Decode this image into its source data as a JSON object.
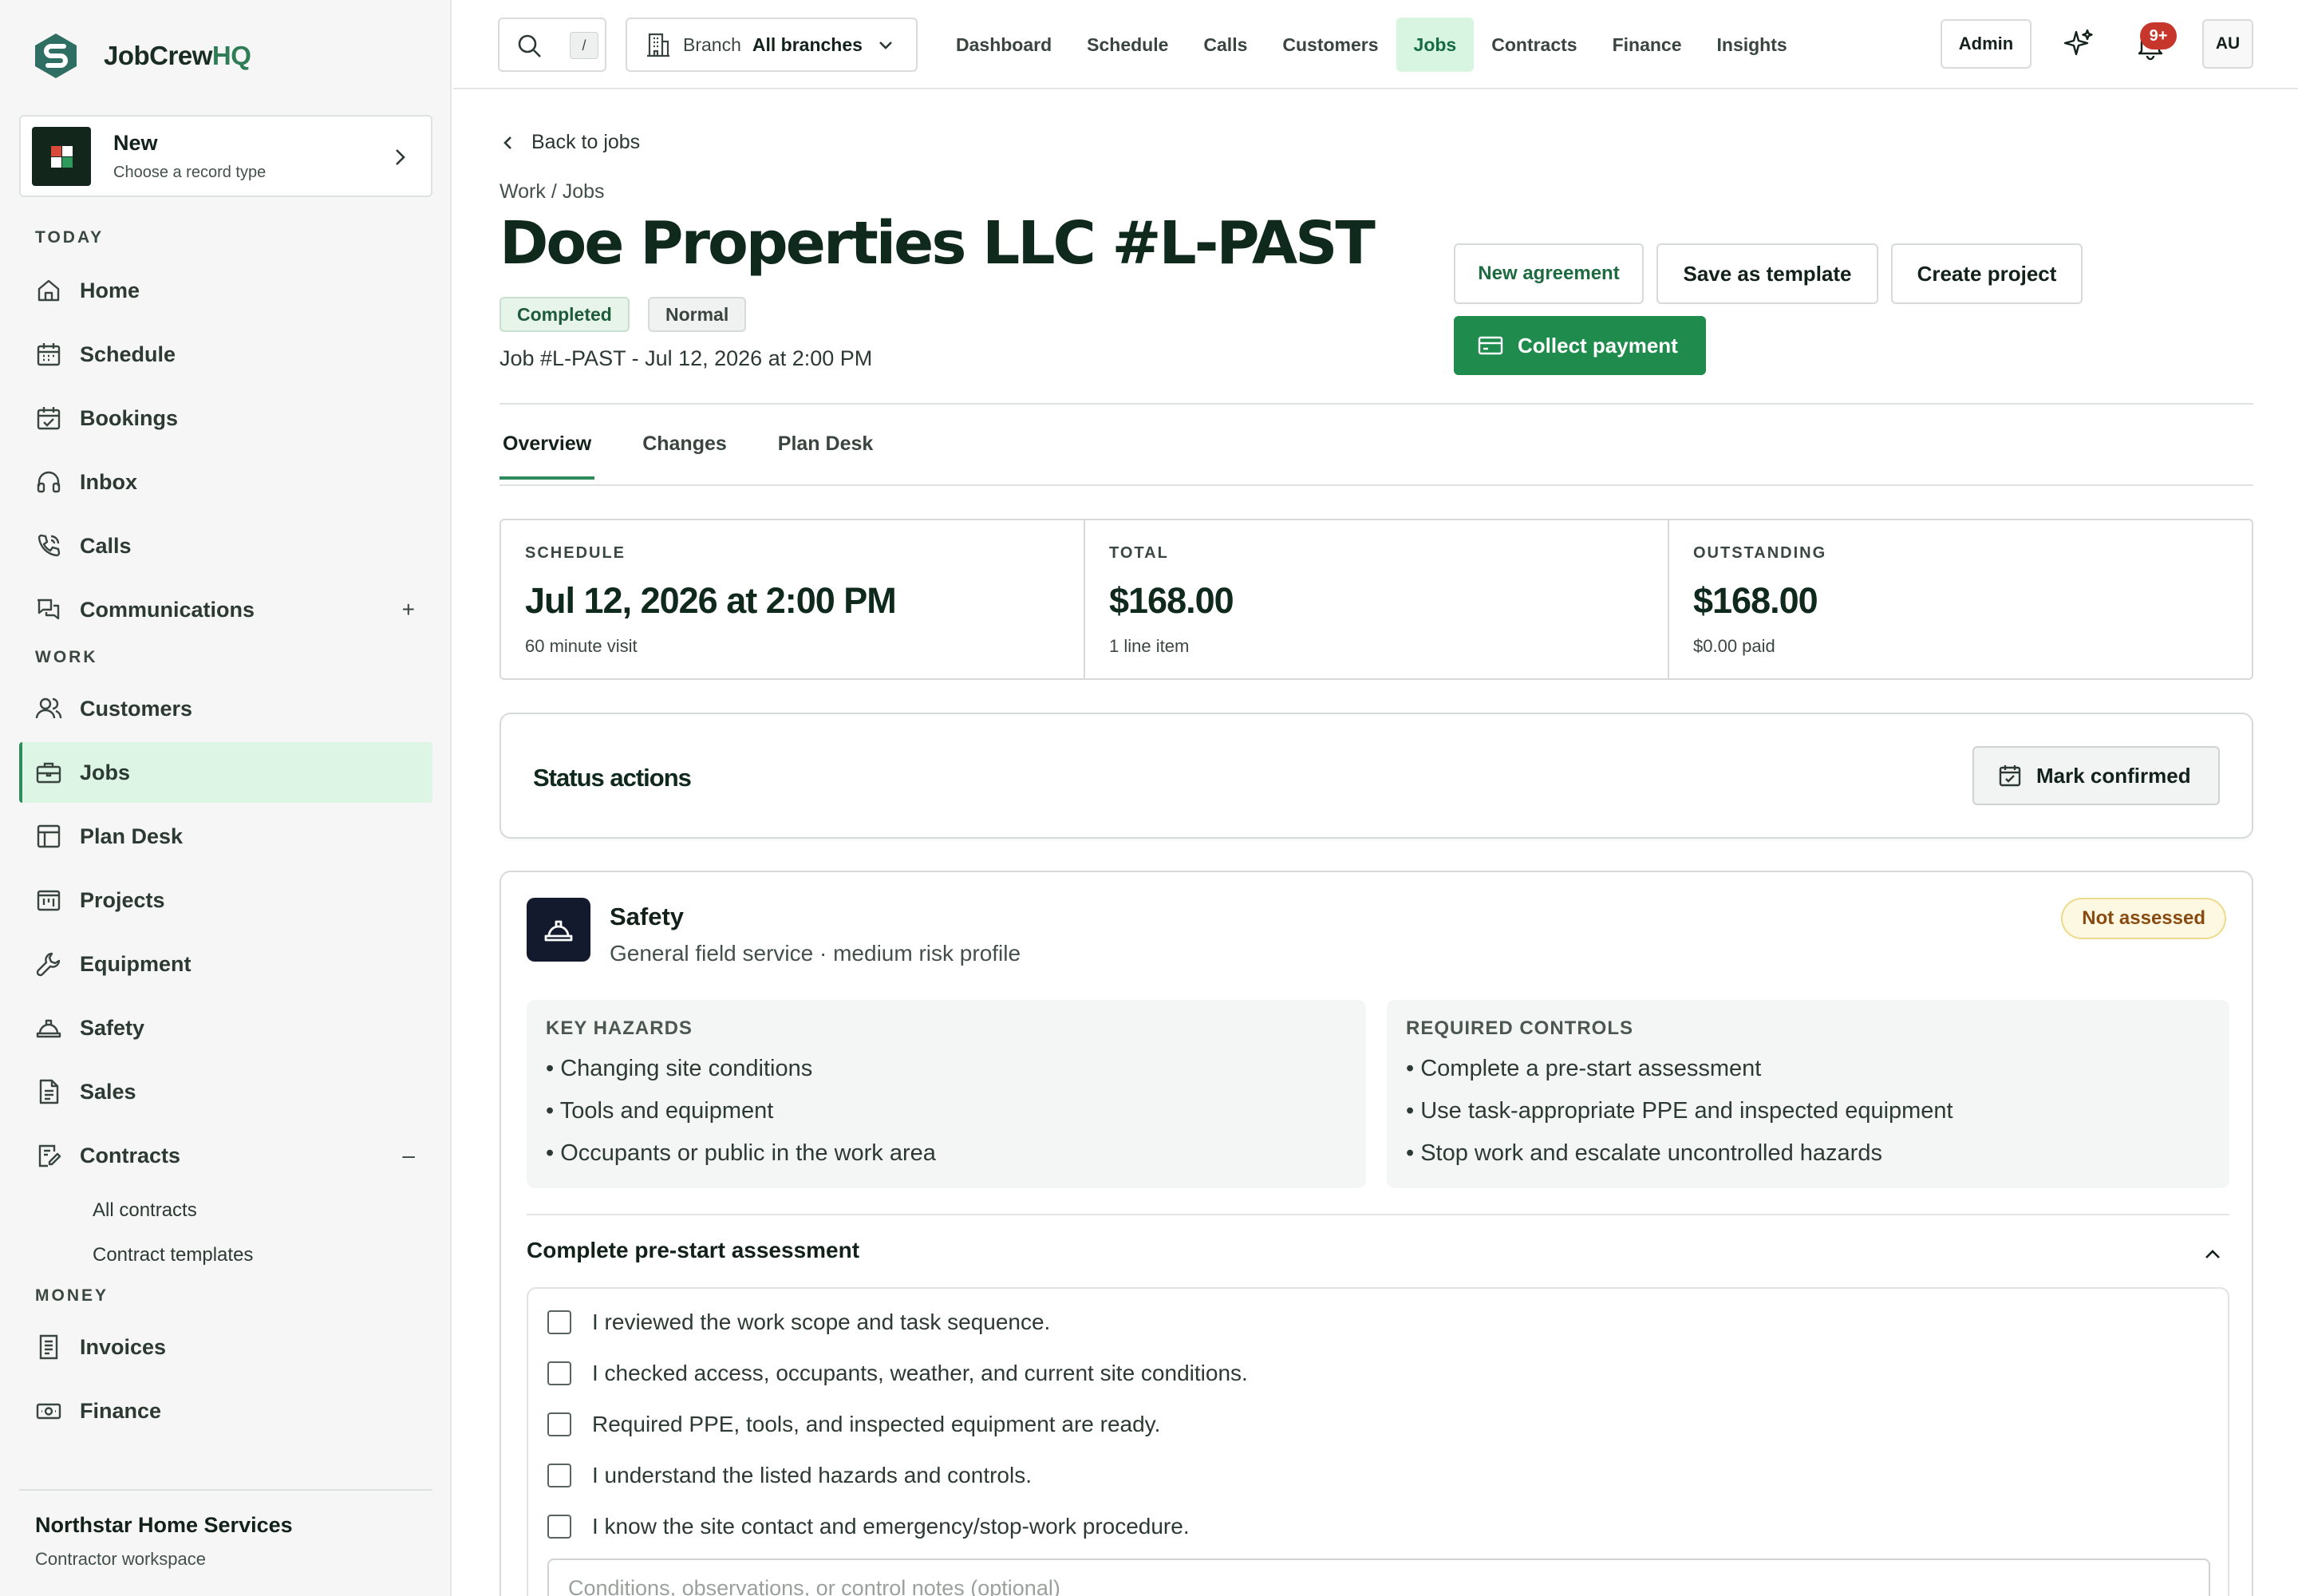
{
  "brand": {
    "name_main": "JobCrew",
    "name_accent": "HQ"
  },
  "new_card": {
    "title": "New",
    "subtitle": "Choose a record type"
  },
  "sidebar": {
    "sections": {
      "today": "TODAY",
      "work": "WORK",
      "money": "MONEY"
    },
    "today_items": [
      {
        "label": "Home",
        "icon": "home-icon"
      },
      {
        "label": "Schedule",
        "icon": "calendar-icon"
      },
      {
        "label": "Bookings",
        "icon": "calendar-check-icon"
      },
      {
        "label": "Inbox",
        "icon": "headset-icon"
      },
      {
        "label": "Calls",
        "icon": "phone-icon"
      },
      {
        "label": "Communications",
        "icon": "chat-icon",
        "toggle": "+"
      }
    ],
    "work_items": [
      {
        "label": "Customers",
        "icon": "users-icon"
      },
      {
        "label": "Jobs",
        "icon": "briefcase-icon",
        "active": true
      },
      {
        "label": "Plan Desk",
        "icon": "layout-icon"
      },
      {
        "label": "Projects",
        "icon": "kanban-icon"
      },
      {
        "label": "Equipment",
        "icon": "wrench-icon"
      },
      {
        "label": "Safety",
        "icon": "hardhat-icon"
      },
      {
        "label": "Sales",
        "icon": "document-icon"
      },
      {
        "label": "Contracts",
        "icon": "contract-edit-icon",
        "toggle": "–"
      }
    ],
    "contracts_sub": [
      "All contracts",
      "Contract templates"
    ],
    "money_items": [
      {
        "label": "Invoices",
        "icon": "invoice-icon"
      },
      {
        "label": "Finance",
        "icon": "cash-icon"
      }
    ]
  },
  "workspace": {
    "name": "Northstar Home Services",
    "subtitle": "Contractor workspace"
  },
  "topbar": {
    "search_shortcut": "/",
    "branch_label": "Branch",
    "branch_value": "All branches",
    "nav": [
      "Dashboard",
      "Schedule",
      "Calls",
      "Customers",
      "Jobs",
      "Contracts",
      "Finance",
      "Insights"
    ],
    "active_nav": "Jobs",
    "admin_label": "Admin",
    "notification_count": "9+",
    "avatar_initials": "AU"
  },
  "job": {
    "back_label": "Back to jobs",
    "breadcrumb": "Work / Jobs",
    "title": "Doe Properties LLC #L-PAST",
    "status": "Completed",
    "priority": "Normal",
    "job_line": "Job #L-PAST - Jul 12, 2026 at 2:00 PM",
    "actions": {
      "new_agreement": "New agreement",
      "save_template": "Save as template",
      "create_project": "Create project",
      "collect_payment": "Collect payment"
    },
    "tabs": [
      "Overview",
      "Changes",
      "Plan Desk"
    ],
    "active_tab": "Overview"
  },
  "stats": [
    {
      "label": "SCHEDULE",
      "value": "Jul 12, 2026 at 2:00 PM",
      "sub": "60 minute visit"
    },
    {
      "label": "TOTAL",
      "value": "$168.00",
      "sub": "1 line item"
    },
    {
      "label": "OUTSTANDING",
      "value": "$168.00",
      "sub": "$0.00 paid"
    }
  ],
  "status_actions": {
    "title": "Status actions",
    "mark_confirmed": "Mark confirmed"
  },
  "safety": {
    "title": "Safety",
    "subtitle": "General field service · medium risk profile",
    "badge": "Not assessed",
    "hazards_label": "KEY HAZARDS",
    "hazards": [
      "Changing site conditions",
      "Tools and equipment",
      "Occupants or public in the work area"
    ],
    "controls_label": "REQUIRED CONTROLS",
    "controls": [
      "Complete a pre-start assessment",
      "Use task-appropriate PPE and inspected equipment",
      "Stop work and escalate uncontrolled hazards"
    ],
    "assessment_title": "Complete pre-start assessment",
    "checklist": [
      "I reviewed the work scope and task sequence.",
      "I checked access, occupants, weather, and current site conditions.",
      "Required PPE, tools, and inspected equipment are ready.",
      "I understand the listed hazards and controls.",
      "I know the site contact and emergency/stop-work procedure."
    ],
    "notes_placeholder": "Conditions, observations, or control notes (optional)"
  },
  "colors": {
    "accent": "#1f8b4c",
    "active_bg": "#dcf5e5",
    "brand_dark": "#0f2a1c",
    "warning_text": "#8a4b12",
    "badge_red": "#c6362b"
  }
}
